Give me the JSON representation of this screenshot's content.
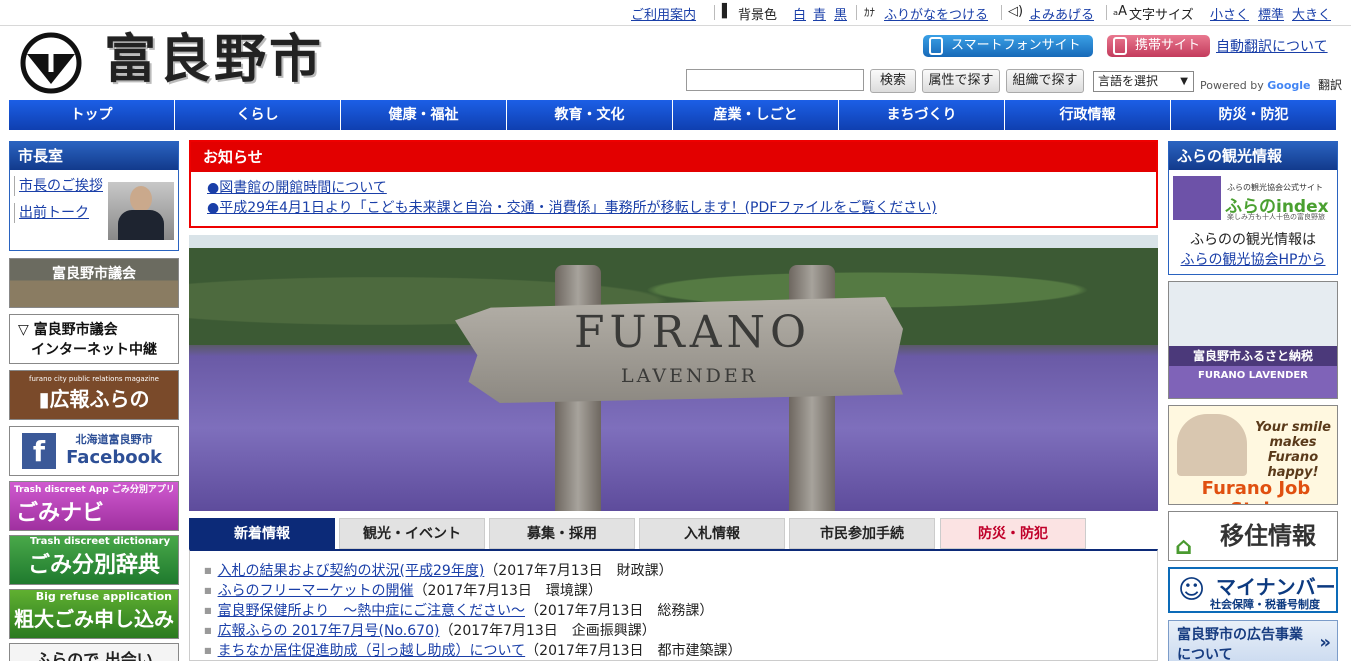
{
  "utility": {
    "guide": "ご利用案内",
    "bg_color_label": "背景色",
    "bg_white": "白",
    "bg_blue": "青",
    "bg_black": "黒",
    "furigana": "ふりがなをつける",
    "read_aloud": "よみあげる",
    "font_size_label": "文字サイズ",
    "font_small": "小さく",
    "font_normal": "標準",
    "font_large": "大きく"
  },
  "header": {
    "site_title": "富良野市",
    "smartphone_site": "スマートフォンサイト",
    "mobile_site": "携帯サイト",
    "auto_translate": "自動翻訳について",
    "search_value": "",
    "search_button": "検索",
    "search_by_attribute": "属性で探す",
    "search_by_org": "組織で探す",
    "language_select": "言語を選択",
    "powered_by": "Powered by",
    "google": "Google",
    "translate": "翻訳"
  },
  "nav": [
    "トップ",
    "くらし",
    "健康・福祉",
    "教育・文化",
    "産業・しごと",
    "まちづくり",
    "行政情報",
    "防災・防犯"
  ],
  "left": {
    "mayor_heading": "市長室",
    "mayor_links": [
      "市長のご挨拶",
      "出前トーク"
    ],
    "banners": {
      "council": "富良野市議会",
      "internet_line1": "富良野市議会",
      "internet_line2": "インターネット中継",
      "koho_sub": "furano city public relations magazine",
      "koho": "広報ふらの",
      "facebook_sub": "北海道富良野市",
      "facebook": "Facebook",
      "gominavi_sub": "Trash discreet App ごみ分別アプリ",
      "gominavi": "ごみナビ",
      "gojiten_sub": "Trash discreet dictionary",
      "gojiten": "ごみ分別辞典",
      "sodai_sub": "Big refuse application",
      "sodai": "粗大ごみ申し込み",
      "deai": "ふらので 出会い"
    }
  },
  "notice": {
    "heading": "お知らせ",
    "items": [
      "●図書館の開館時間について",
      "●平成29年4月1日より「こども未来課と自治・交通・消費係」事務所が移転します！(PDFファイルをご覧ください)"
    ]
  },
  "hero": {
    "sign_word1": "FURANO",
    "sign_word2": "LAVENDER"
  },
  "tabs": [
    "新着情報",
    "観光・イベント",
    "募集・採用",
    "入札情報",
    "市民参加手続",
    "防災・防犯"
  ],
  "news": [
    {
      "title": "入札の結果および契約の状況(平成29年度)",
      "meta": "（2017年7月13日　財政課）"
    },
    {
      "title": "ふらのフリーマーケットの開催",
      "meta": "（2017年7月13日　環境課）"
    },
    {
      "title": "富良野保健所より　～熱中症にご注意ください～",
      "meta": "（2017年7月13日　総務課）"
    },
    {
      "title": "広報ふらの 2017年7月号(No.670)",
      "meta": "（2017年7月13日　企画振興課）"
    },
    {
      "title": "まちなか居住促進助成（引っ越し助成）について",
      "meta": "（2017年7月13日　都市建築課）"
    }
  ],
  "right": {
    "tour_heading": "ふらの観光情報",
    "tour_logo_sub": "ふらの観光協会公式サイト",
    "tour_logo": "ふらのindex",
    "tour_logo_tagline": "楽しみ方も十人十色の富良野旅",
    "tour_text1": "ふらのの観光情報は",
    "tour_text2": "ふらの観光協会HPから",
    "furusato": "富良野市ふるさと納税",
    "furusato_sub": "FURANO LAVENDER",
    "job_line1": "Your smile makes Furano happy!",
    "job_line2": "Furano Job Style",
    "iju": "移住情報",
    "mynumber": "マイナンバー",
    "mynumber_sub": "社会保障・税番号制度",
    "koukoku": "富良野市の広告事業について"
  },
  "colors": {
    "nav_blue": "#1a56d0",
    "notice_red": "#e30000",
    "tab_active": "#0c2a78"
  }
}
